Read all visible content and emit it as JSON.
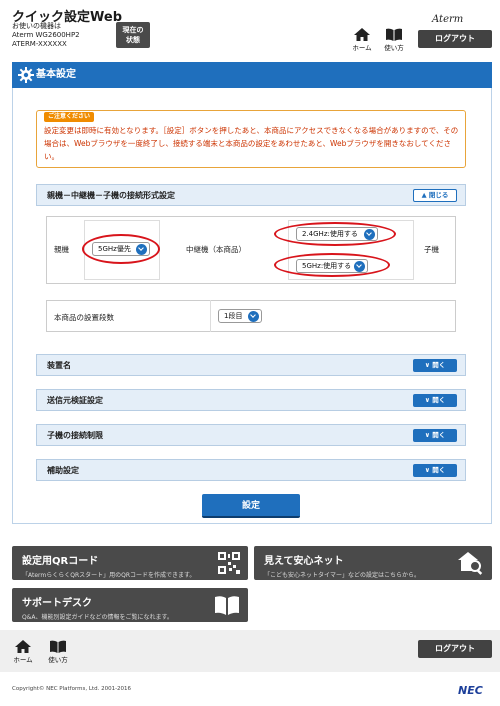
{
  "header": {
    "title": "クイック設定Web",
    "device_label": "お使いの機器は",
    "device_model": "Aterm WG2600HP2",
    "device_id": "ATERM-XXXXXX",
    "status_line1": "現在の",
    "status_line2": "状態",
    "logo": "Aterm",
    "home_label": "ホーム",
    "help_label": "使い方",
    "logout_label": "ログアウト"
  },
  "section": {
    "title": "基本設定"
  },
  "notice": {
    "badge": "ご注意ください",
    "text": "設定変更は即時に有効となります。［設定］ボタンを押したあと、本商品にアクセスできなくなる場合がありますので、その場合は、Webブラウザを一度終了し、接続する端末と本商品の設定をあわせたあと、Webブラウザを開きなおしてください。"
  },
  "connection": {
    "header": "親機－中継機－子機の接続形式設定",
    "collapse_label": "閉じる",
    "parent_label": "親機",
    "parent_select": "5GHz優先",
    "repeater_label": "中継機（本商品）",
    "repeater_select_24": "2.4GHz:使用する",
    "repeater_select_5": "5GHz:使用する",
    "child_label": "子機",
    "stage_label": "本商品の設置段数",
    "stage_select": "1段目"
  },
  "accordions": [
    {
      "label": "装置名",
      "button": "開く"
    },
    {
      "label": "送信元検証設定",
      "button": "開く"
    },
    {
      "label": "子機の接続制限",
      "button": "開く"
    },
    {
      "label": "補助設定",
      "button": "開く"
    }
  ],
  "set_button": "設定",
  "tiles": {
    "qr_title": "設定用QRコード",
    "qr_desc": "「AtermらくらくQRスタート」用のQRコードを作成できます。",
    "anshin_title": "見えて安心ネット",
    "anshin_desc": "「こども安心ネットタイマー」などの設定はこちらから。",
    "support_title": "サポートデスク",
    "support_desc": "Q&A、機能別設定ガイドなどの情報をご覧になれます。"
  },
  "footer": {
    "home_label": "ホーム",
    "help_label": "使い方",
    "logout_label": "ログアウト",
    "copyright": "Copyright© NEC Platforms, Ltd. 2001-2016",
    "brand": "NEC"
  },
  "colors": {
    "primary": "#1f6fbd",
    "dark": "#424242",
    "alert": "#d8141b",
    "notice": "#f08c00"
  }
}
